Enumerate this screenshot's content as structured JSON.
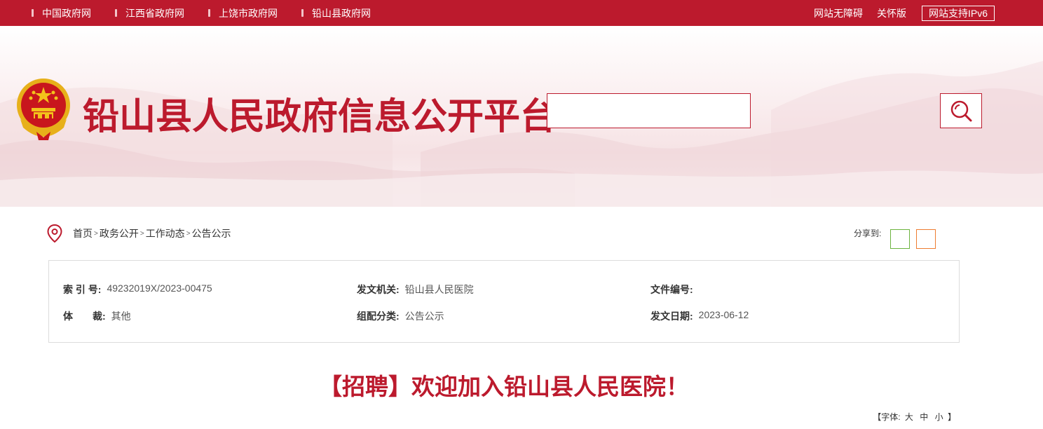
{
  "topbar": {
    "links": [
      "中国政府网",
      "江西省政府网",
      "上饶市政府网",
      "铅山县政府网"
    ],
    "accessibility": "网站无障碍",
    "care_mode": "关怀版",
    "ipv6": "网站支持IPv6"
  },
  "header": {
    "title": "铅山县人民政府信息公开平台",
    "search_placeholder": ""
  },
  "breadcrumb": {
    "items": [
      "首页",
      "政务公开",
      "工作动态",
      "公告公示"
    ],
    "separator": ">"
  },
  "share": {
    "label": "分享到:"
  },
  "meta": {
    "index_label": "索 引 号:",
    "index_value": "49232019X/2023-00475",
    "issuer_label": "发文机关:",
    "issuer_value": "铅山县人民医院",
    "docno_label": "文件编号:",
    "docno_value": "",
    "genre_label": "体　　裁:",
    "genre_value": "其他",
    "category_label": "组配分类:",
    "category_value": "公告公示",
    "date_label": "发文日期:",
    "date_value": "2023-06-12"
  },
  "article": {
    "title": "【招聘】欢迎加入铅山县人民医院！"
  },
  "font_size": {
    "prefix": "【字体:",
    "large": "大",
    "medium": "中",
    "small": "小",
    "suffix": "】"
  },
  "colors": {
    "brand_red": "#bc1a2d",
    "weixin_green": "#6cb33f",
    "weibo_orange": "#ee7d31"
  }
}
